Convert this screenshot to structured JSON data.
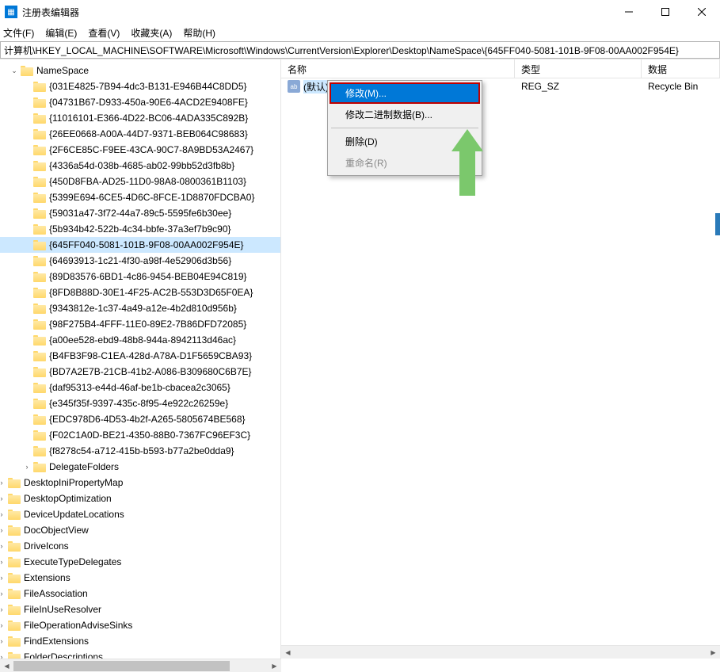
{
  "titlebar": {
    "app_title": "注册表编辑器"
  },
  "menu": {
    "file": "文件(F)",
    "edit": "编辑(E)",
    "view": "查看(V)",
    "favorites": "收藏夹(A)",
    "help": "帮助(H)"
  },
  "addressbar": {
    "path": "计算机\\HKEY_LOCAL_MACHINE\\SOFTWARE\\Microsoft\\Windows\\CurrentVersion\\Explorer\\Desktop\\NameSpace\\{645FF040-5081-101B-9F08-00AA002F954E}"
  },
  "tree": {
    "root": "NameSpace",
    "guids": [
      "{031E4825-7B94-4dc3-B131-E946B44C8DD5}",
      "{04731B67-D933-450a-90E6-4ACD2E9408FE}",
      "{11016101-E366-4D22-BC06-4ADA335C892B}",
      "{26EE0668-A00A-44D7-9371-BEB064C98683}",
      "{2F6CE85C-F9EE-43CA-90C7-8A9BD53A2467}",
      "{4336a54d-038b-4685-ab02-99bb52d3fb8b}",
      "{450D8FBA-AD25-11D0-98A8-0800361B1103}",
      "{5399E694-6CE5-4D6C-8FCE-1D8870FDCBA0}",
      "{59031a47-3f72-44a7-89c5-5595fe6b30ee}",
      "{5b934b42-522b-4c34-bbfe-37a3ef7b9c90}",
      "{645FF040-5081-101B-9F08-00AA002F954E}",
      "{64693913-1c21-4f30-a98f-4e52906d3b56}",
      "{89D83576-6BD1-4c86-9454-BEB04E94C819}",
      "{8FD8B88D-30E1-4F25-AC2B-553D3D65F0EA}",
      "{9343812e-1c37-4a49-a12e-4b2d810d956b}",
      "{98F275B4-4FFF-11E0-89E2-7B86DFD72085}",
      "{a00ee528-ebd9-48b8-944a-8942113d46ac}",
      "{B4FB3F98-C1EA-428d-A78A-D1F5659CBA93}",
      "{BD7A2E7B-21CB-41b2-A086-B309680C6B7E}",
      "{daf95313-e44d-46af-be1b-cbacea2c3065}",
      "{e345f35f-9397-435c-8f95-4e922c26259e}",
      "{EDC978D6-4D53-4b2f-A265-5805674BE568}",
      "{F02C1A0D-BE21-4350-88B0-7367FC96EF3C}",
      "{f8278c54-a712-415b-b593-b77a2be0dda9}"
    ],
    "delegate": "DelegateFolders",
    "siblings": [
      "DesktopIniPropertyMap",
      "DesktopOptimization",
      "DeviceUpdateLocations",
      "DocObjectView",
      "DriveIcons",
      "ExecuteTypeDelegates",
      "Extensions",
      "FileAssociation",
      "FileInUseResolver",
      "FileOperationAdviseSinks",
      "FindExtensions",
      "FolderDescriptions"
    ]
  },
  "list": {
    "col_name": "名称",
    "col_type": "类型",
    "col_data": "数据",
    "row_name": "(默认)",
    "row_type": "REG_SZ",
    "row_data": "Recycle Bin"
  },
  "context_menu": {
    "modify": "修改(M)...",
    "modify_binary": "修改二进制数据(B)...",
    "delete": "删除(D)",
    "rename": "重命名(R)"
  }
}
